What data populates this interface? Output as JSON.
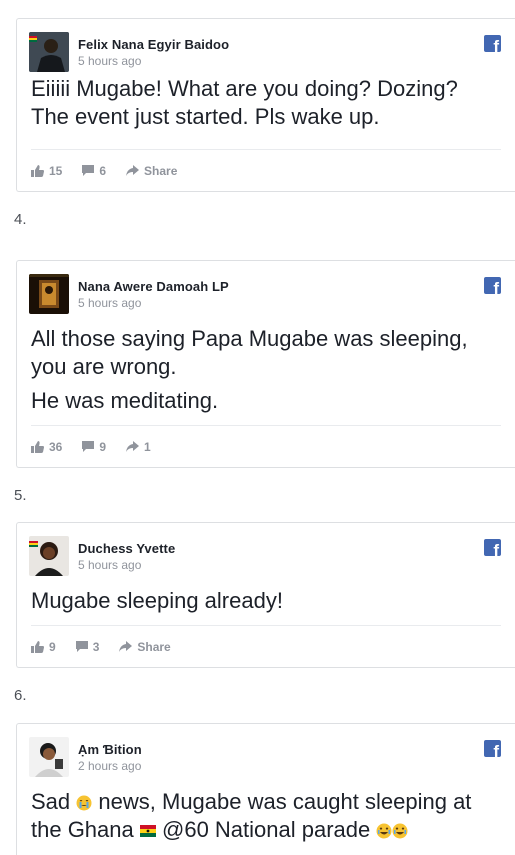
{
  "posts": [
    {
      "author": "Felix Nana Egyir Baidoo",
      "time": "5 hours ago",
      "lines": [
        "Eiiiii Mugabe! What are you doing? Dozing? The event just started. Pls wake up."
      ],
      "likes": "15",
      "comments": "6",
      "share": "Share"
    },
    {
      "number": "4.",
      "author": "Nana Awere Damoah LP",
      "time": "5 hours ago",
      "lines": [
        "All those saying Papa Mugabe was sleeping, you are wrong.",
        "He was meditating."
      ],
      "likes": "36",
      "comments": "9",
      "share": "1"
    },
    {
      "number": "5.",
      "author": "Duchess Yvette",
      "time": "5 hours ago",
      "lines": [
        "Mugabe sleeping already!"
      ],
      "likes": "9",
      "comments": "3",
      "share": "Share"
    },
    {
      "number": "6.",
      "author": "Ạm Ɓition",
      "time": "2 hours ago",
      "text_a": "Sad",
      "text_b": "news, Mugabe was caught sleeping at the Ghana",
      "text_c": "@60 National parade"
    }
  ],
  "icons": {
    "facebook": "facebook-icon",
    "like": "thumbs-up-icon",
    "comment": "comment-icon",
    "share": "share-arrow-icon"
  },
  "colors": {
    "brand": "#4267b2",
    "meta": "#90949c",
    "text": "#1d2129"
  }
}
